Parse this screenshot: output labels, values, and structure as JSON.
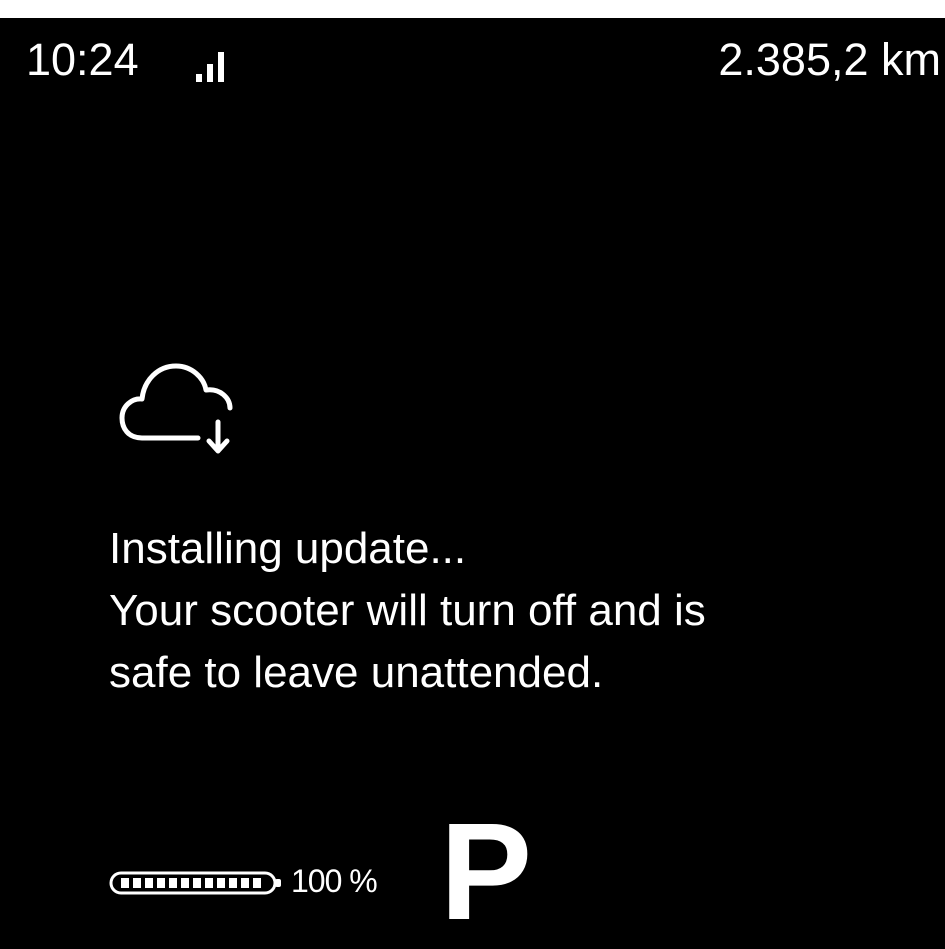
{
  "status_bar": {
    "time": "10:24",
    "signal_icon": "signal-bars-icon",
    "odometer": "2.385,2 km"
  },
  "update": {
    "icon": "cloud-download-icon",
    "lines": [
      "Installing update...",
      "Your scooter will turn off and is",
      "safe to leave unattended."
    ]
  },
  "battery": {
    "level": 1.0,
    "percent_label": "100 %"
  },
  "gear": {
    "label": "P"
  },
  "colors": {
    "background": "#000000",
    "foreground": "#ffffff"
  }
}
